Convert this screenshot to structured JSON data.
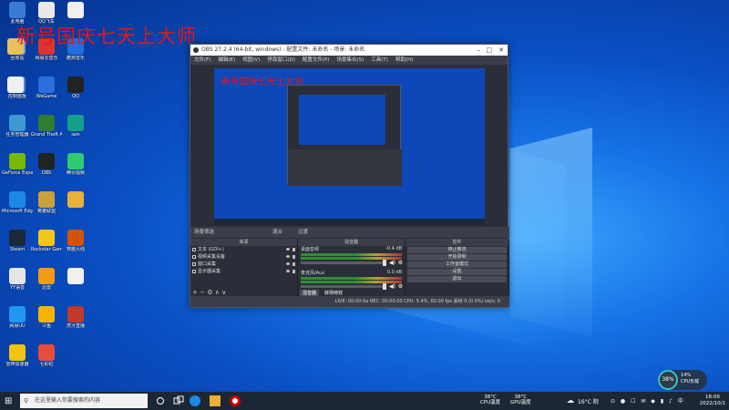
{
  "overlay": {
    "text": "新号国庆七天上大师"
  },
  "desktop_icons": [
    {
      "label": "此电脑",
      "color": "#3a7bd5"
    },
    {
      "label": "QQ飞车",
      "color": "#e9e9e9"
    },
    {
      "label": "",
      "color": "#f0f0f0"
    },
    {
      "label": "回收站",
      "color": "#6aa0d8"
    },
    {
      "label": "网易云音乐",
      "color": "#d33"
    },
    {
      "label": "酷狗音乐",
      "color": "#1f6fe0"
    },
    {
      "label": "",
      "color": "#e8c060"
    },
    {
      "label": "控制面板",
      "color": "#4a86d9"
    },
    {
      "label": "WeGame",
      "color": "#2a6fdb"
    },
    {
      "label": "QQ",
      "color": "#222"
    },
    {
      "label": "",
      "color": "#f0f0f0"
    },
    {
      "label": "任务管理器",
      "color": "#3d9ad1"
    },
    {
      "label": "Grand Theft Auto V",
      "color": "#2e7d32"
    },
    {
      "label": "iam",
      "color": "#16a085"
    },
    {
      "label": "GeForce Experience",
      "color": "#76b900"
    },
    {
      "label": "OBS",
      "color": "#222"
    },
    {
      "label": "腾讯视频",
      "color": "#2ecc71"
    },
    {
      "label": "Microsoft Edge",
      "color": "#1e88e5"
    },
    {
      "label": "英雄联盟",
      "color": "#c9a13b"
    },
    {
      "label": "",
      "color": "#e8b13a"
    },
    {
      "label": "Steam",
      "color": "#1b2838"
    },
    {
      "label": "Rockstar Games",
      "color": "#f5c518"
    },
    {
      "label": "穿越火线",
      "color": "#d35400"
    },
    {
      "label": "YY语音",
      "color": "#e6e6e6"
    },
    {
      "label": "迅雷",
      "color": "#f39c12"
    },
    {
      "label": "",
      "color": "#f0f0f0"
    },
    {
      "label": "网易UU",
      "color": "#2196f3"
    },
    {
      "label": "斗鱼",
      "color": "#f7b500"
    },
    {
      "label": "虎牙直播",
      "color": "#c0392b"
    },
    {
      "label": "雷神加速器",
      "color": "#f1c40f"
    },
    {
      "label": "七彩虹",
      "color": "#e74c3c"
    }
  ],
  "obs": {
    "title": "OBS 27.2.4 (64-bit, windows) - 配置文件: 未命名 - 场景: 未命名",
    "menu": [
      "文件(F)",
      "编辑(E)",
      "视图(V)",
      "停靠窗口(D)",
      "配置文件(P)",
      "场景集合(S)",
      "工具(T)",
      "帮助(H)"
    ],
    "preview_overlay_text": "新号国庆七天上大师",
    "dock_header": {
      "left": "场景筛选",
      "right_a": "混合",
      "right_b": "过渡"
    },
    "sources_title": "来源",
    "sources": [
      "文本 (GDI+)",
      "视频采集设备",
      "窗口采集",
      "显示器采集"
    ],
    "mixer_title": "混音器",
    "mixer": [
      {
        "name": "桌面音频",
        "db": "-0.4 dB"
      },
      {
        "name": "麦克风/Aux",
        "db": "0.0 dB"
      }
    ],
    "mixer_tabs": [
      "混音器",
      "转场特效"
    ],
    "controls_title": "控件",
    "controls": [
      "停止推流",
      "开始录制",
      "工作室模式",
      "设置",
      "退出"
    ],
    "status": "LIVE: 00:00:0a   REC: 00:00:00   CPU: 5.4%, 60.00 fps   丢帧 0 (0.0%)   kb/s: 0"
  },
  "taskbar": {
    "search_placeholder": "在这里输入你要搜索的内容",
    "temps": [
      {
        "value": "38°C",
        "label": "CPU温度"
      },
      {
        "value": "38°C",
        "label": "GPU温度"
      }
    ],
    "weather": "16°C 阴",
    "time": "18:09",
    "date": "2022/10/1"
  },
  "perf_widget": {
    "percent": "38%",
    "cpu": "14%",
    "label": "CPU负载"
  }
}
